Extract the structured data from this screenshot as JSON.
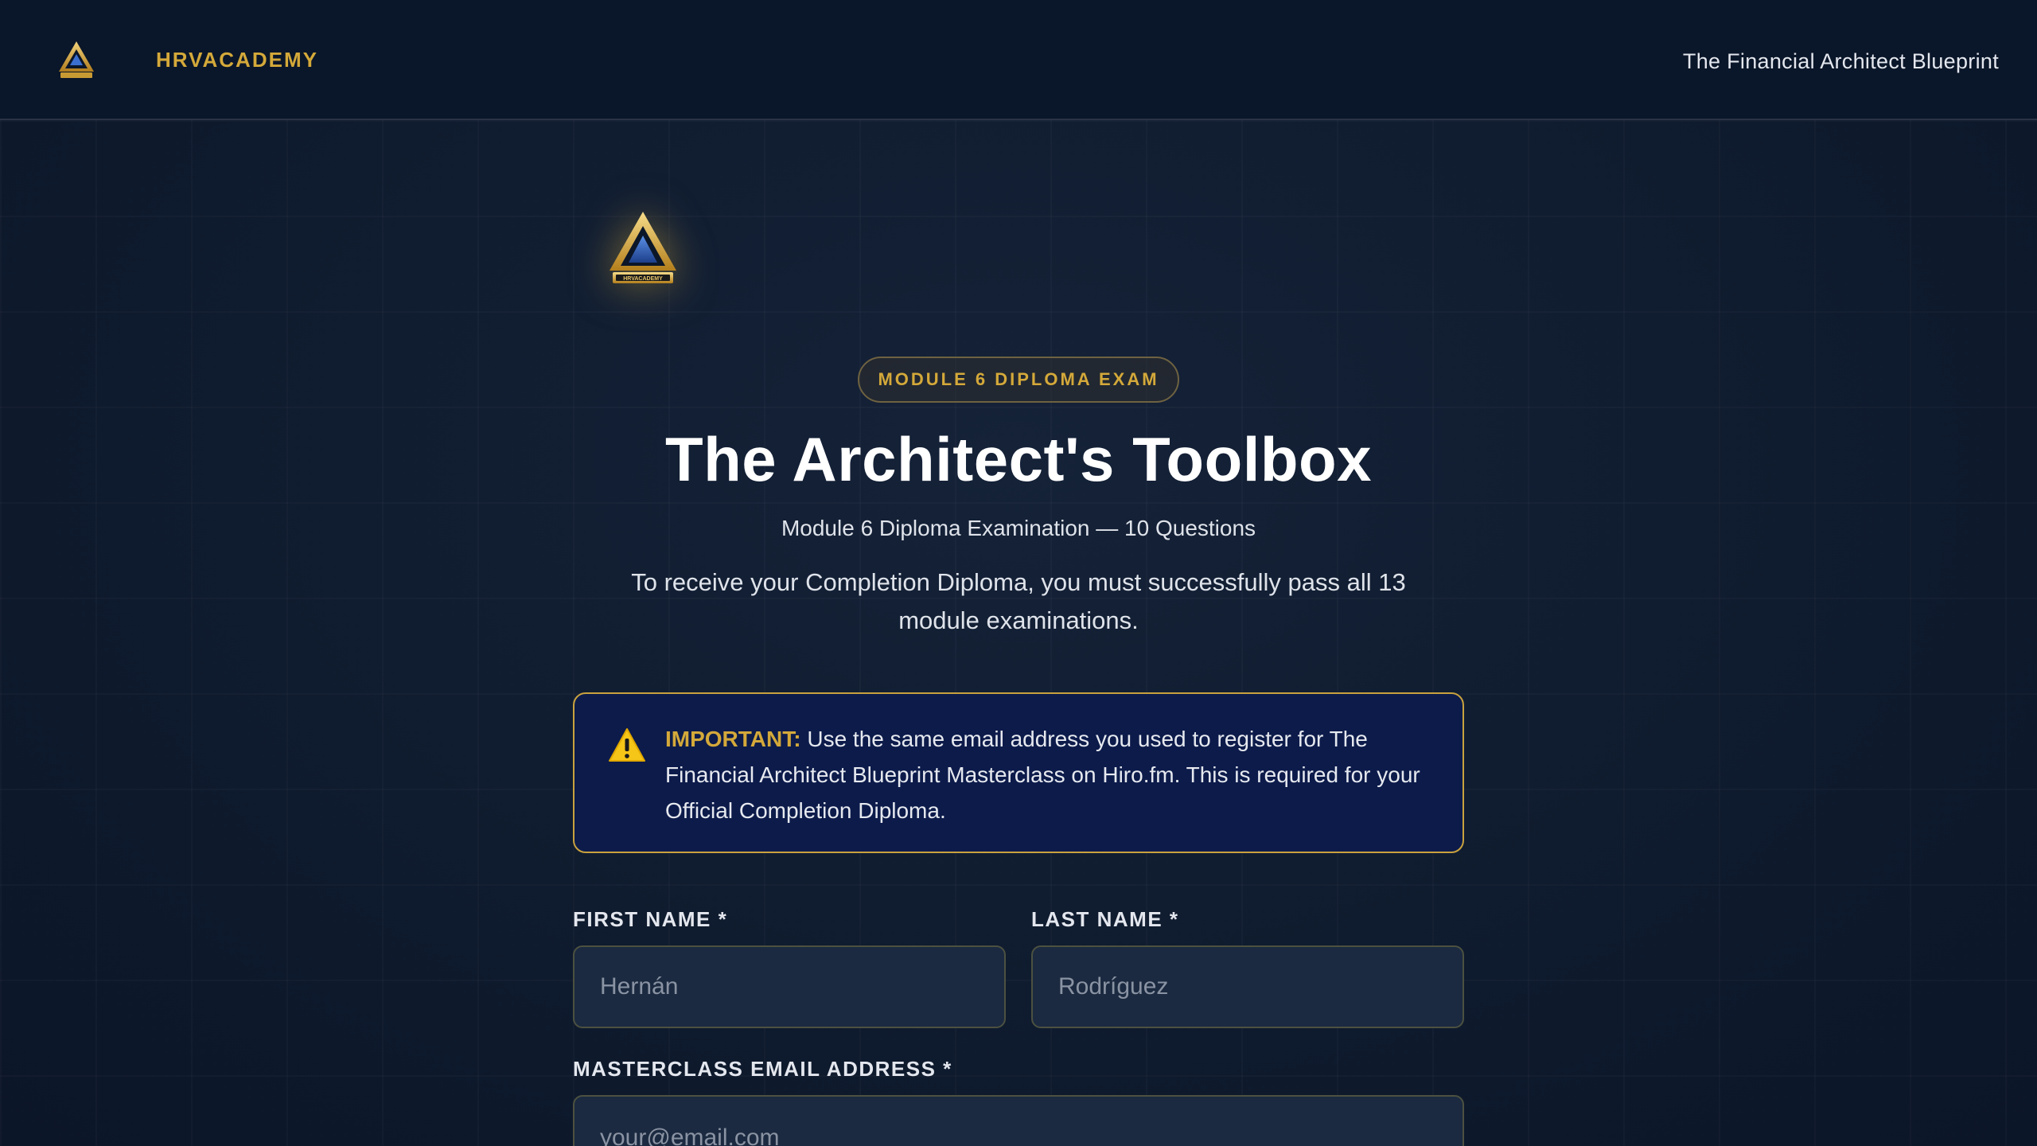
{
  "header": {
    "brand": "HRVACADEMY",
    "logo_icon": "academy-triangle-logo-icon",
    "course_title": "The Financial Architect Blueprint"
  },
  "hero": {
    "logo_icon": "academy-emblem-icon",
    "logo_text": "HRVACADEMY",
    "badge": "MODULE 6 DIPLOMA EXAM",
    "title": "The Architect's Toolbox",
    "subtitle": "Module 6 Diploma Examination — 10 Questions",
    "description": "To receive your Completion Diploma, you must successfully pass all 13 module examinations."
  },
  "notice": {
    "icon": "warning-icon",
    "label": "IMPORTANT:",
    "text": "Use the same email address you used to register for The Financial Architect Blueprint Masterclass on Hiro.fm. This is required for your Official Completion Diploma."
  },
  "form": {
    "first_name": {
      "label": "FIRST NAME *",
      "placeholder": "Hernán",
      "value": ""
    },
    "last_name": {
      "label": "LAST NAME *",
      "placeholder": "Rodríguez",
      "value": ""
    },
    "email": {
      "label": "MASTERCLASS EMAIL ADDRESS *",
      "placeholder": "your@email.com",
      "value": ""
    }
  },
  "colors": {
    "background": "#0f1b2e",
    "accent_gold": "#d4a93a",
    "notice_bg": "#0c1b4a",
    "input_bg": "#1b2a40"
  }
}
